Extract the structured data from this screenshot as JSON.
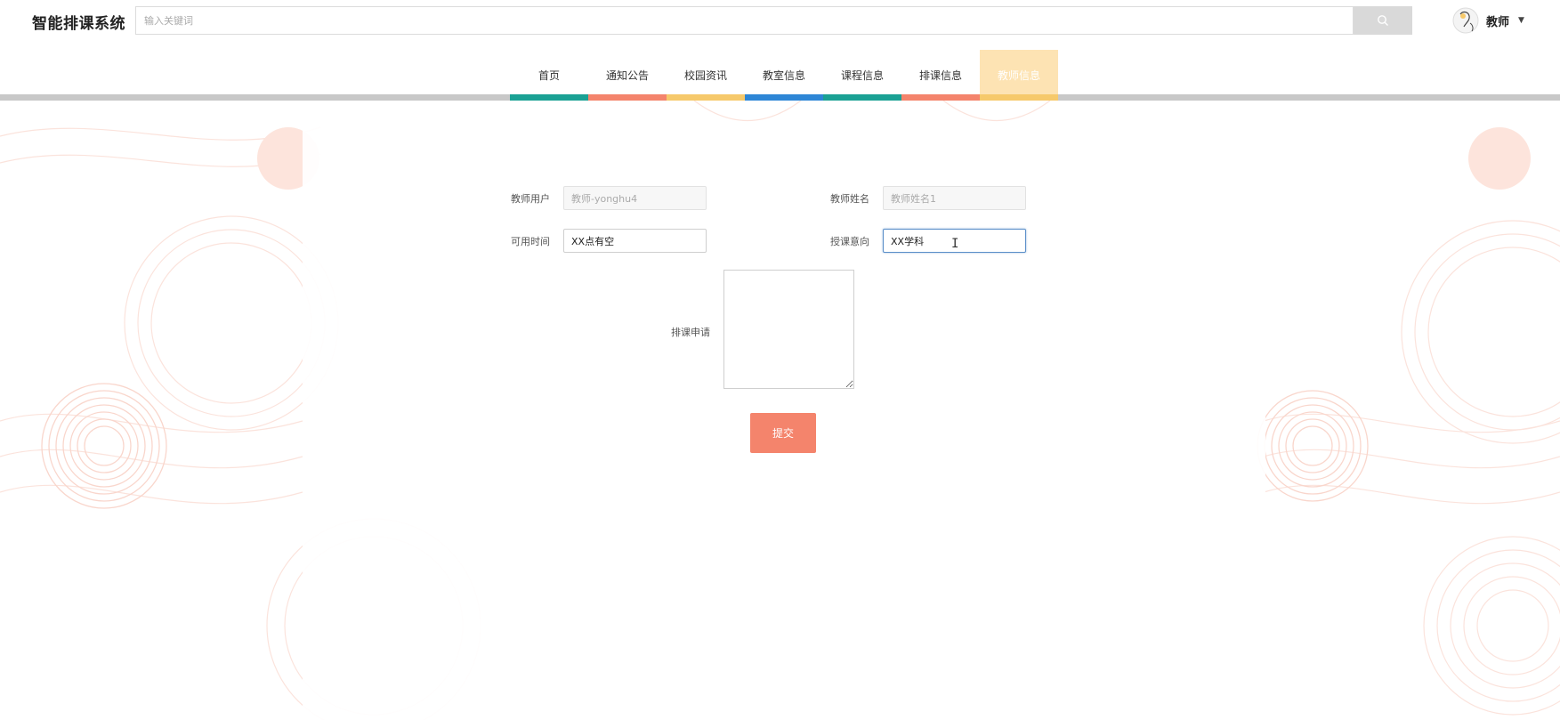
{
  "app": {
    "brand": "智能排课系统"
  },
  "search": {
    "placeholder": "输入关键词"
  },
  "user": {
    "name": "教师"
  },
  "nav": {
    "items": [
      {
        "label": "首页",
        "color": "#1aa194"
      },
      {
        "label": "通知公告",
        "color": "#f4846c"
      },
      {
        "label": "校园资讯",
        "color": "#f6c96b"
      },
      {
        "label": "教室信息",
        "color": "#2e86d6"
      },
      {
        "label": "课程信息",
        "color": "#1aa194"
      },
      {
        "label": "排课信息",
        "color": "#f4846c"
      },
      {
        "label": "教师信息",
        "color": "#f6c96b",
        "active": true
      }
    ]
  },
  "form": {
    "teacher_user": {
      "label": "教师用户",
      "value": "教师-yonghu4"
    },
    "teacher_name": {
      "label": "教师姓名",
      "value": "教师姓名1"
    },
    "available_time": {
      "label": "可用时间",
      "value": "XX点有空"
    },
    "teaching_intent": {
      "label": "授课意向",
      "value": "XX学科"
    },
    "schedule_request": {
      "label": "排课申请",
      "value": ""
    },
    "submit_label": "提交"
  },
  "colors": {
    "accent": "#f4846c",
    "teal": "#1aa194",
    "yellow": "#f6c96b",
    "blue": "#2e86d6"
  }
}
